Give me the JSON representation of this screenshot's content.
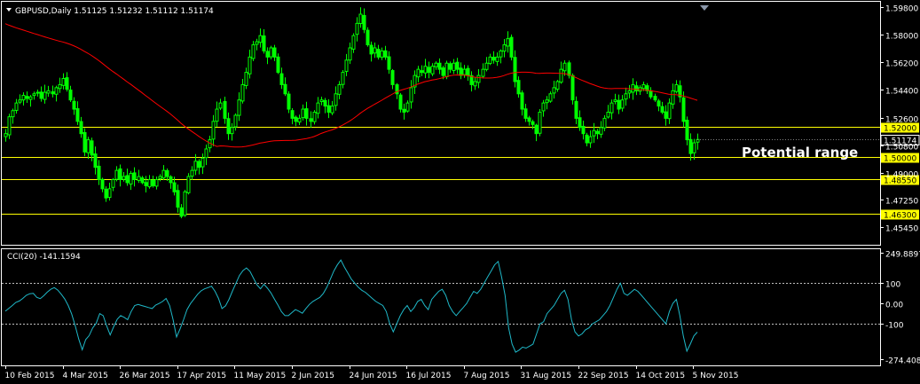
{
  "header": {
    "symbol_line": "GBPUSD,Daily  1.51125 1.51232 1.51112 1.51174",
    "indicator_line": "CCI(20) -141.1594"
  },
  "annotation": "Potential range",
  "colors": {
    "background": "#000000",
    "candle": "#00ff00",
    "moving_average": "#ff0000",
    "horizontal_level": "#ffff00",
    "cci_line": "#1fb8c8",
    "border": "#ffffff",
    "text": "#ffffff"
  },
  "chart_data": [
    {
      "type": "candlestick",
      "title": "GBPUSD,Daily",
      "ylim": [
        1.4464,
        1.5987
      ],
      "price_ticks": [
        "1.59800",
        "1.58000",
        "1.56200",
        "1.54400",
        "1.52600",
        "1.50800",
        "1.49000",
        "1.47250",
        "1.45450"
      ],
      "current_price_label": "1.51174",
      "horizontal_levels": [
        {
          "value": 1.52,
          "label": "1.52000"
        },
        {
          "value": 1.5,
          "label": "1.50000"
        },
        {
          "value": 1.4855,
          "label": "1.48550"
        },
        {
          "value": 1.463,
          "label": "1.46300"
        }
      ],
      "date_labels": [
        "10 Feb 2015",
        "4 Mar 2015",
        "26 Mar 2015",
        "17 Apr 2015",
        "11 May 2015",
        "2 Jun 2015",
        "24 Jun 2015",
        "16 Jul 2015",
        "7 Aug 2015",
        "31 Aug 2015",
        "22 Sep 2015",
        "14 Oct 2015",
        "5 Nov 2015"
      ],
      "close_series": [
        1.5155,
        1.5265,
        1.5305,
        1.5355,
        1.5375,
        1.5405,
        1.5385,
        1.5395,
        1.5415,
        1.5425,
        1.5385,
        1.5425,
        1.5435,
        1.5415,
        1.5455,
        1.5475,
        1.5515,
        1.5445,
        1.5375,
        1.5315,
        1.5235,
        1.5155,
        1.5035,
        1.5115,
        1.5015,
        1.4935,
        1.4855,
        1.4795,
        1.4735,
        1.4795,
        1.4855,
        1.4915,
        1.4855,
        1.4875,
        1.4835,
        1.4895,
        1.4855,
        1.4875,
        1.4835,
        1.4815,
        1.4855,
        1.4815,
        1.4855,
        1.4875,
        1.4915,
        1.4875,
        1.4835,
        1.4775,
        1.4675,
        1.4615,
        1.4775,
        1.4875,
        1.4915,
        1.4975,
        1.4935,
        1.4995,
        1.5055,
        1.5115,
        1.5235,
        1.5315,
        1.5355,
        1.5255,
        1.5155,
        1.5195,
        1.5275,
        1.5375,
        1.5475,
        1.5555,
        1.5655,
        1.5735,
        1.5755,
        1.5795,
        1.5695,
        1.5655,
        1.5715,
        1.5655,
        1.5555,
        1.5475,
        1.5415,
        1.5315,
        1.5255,
        1.5235,
        1.5255,
        1.5315,
        1.5255,
        1.5235,
        1.5295,
        1.5355,
        1.5375,
        1.5335,
        1.5295,
        1.5335,
        1.5415,
        1.5475,
        1.5555,
        1.5635,
        1.5715,
        1.5795,
        1.5875,
        1.5935,
        1.5835,
        1.5735,
        1.5675,
        1.5715,
        1.5655,
        1.5695,
        1.5655,
        1.5575,
        1.5475,
        1.5415,
        1.5315,
        1.5295,
        1.5355,
        1.5455,
        1.5535,
        1.5575,
        1.5555,
        1.5595,
        1.5555,
        1.5595,
        1.5615,
        1.5575,
        1.5535,
        1.5615,
        1.5575,
        1.5615,
        1.5575,
        1.5535,
        1.5575,
        1.5535,
        1.5475,
        1.5495,
        1.5535,
        1.5575,
        1.5615,
        1.5655,
        1.5635,
        1.5655,
        1.5695,
        1.5735,
        1.5775,
        1.5655,
        1.5495,
        1.5415,
        1.5315,
        1.5255,
        1.5235,
        1.5215,
        1.5155,
        1.5295,
        1.5355,
        1.5375,
        1.5415,
        1.5455,
        1.5495,
        1.5575,
        1.5615,
        1.5535,
        1.5375,
        1.5255,
        1.5195,
        1.5155,
        1.5095,
        1.5135,
        1.5175,
        1.5155,
        1.5195,
        1.5255,
        1.5295,
        1.5355,
        1.5375,
        1.5315,
        1.5375,
        1.5415,
        1.5435,
        1.5475,
        1.5435,
        1.5455,
        1.5475,
        1.5435,
        1.5395,
        1.5375,
        1.5335,
        1.5295,
        1.5255,
        1.5355,
        1.5435,
        1.5475,
        1.5395,
        1.5235,
        1.5115,
        1.5025,
        1.5095,
        1.5117
      ]
    },
    {
      "type": "line",
      "title": "CCI(20)",
      "current_value": -141.1594,
      "ylim": [
        -274.4083,
        249.8897
      ],
      "ticks": [
        "249.8897",
        "100",
        "0.00",
        "-100",
        "-274.4083"
      ],
      "reference_levels": [
        100,
        -100
      ],
      "values": [
        -38,
        -24,
        -10,
        5,
        12,
        25,
        40,
        48,
        50,
        30,
        24,
        38,
        56,
        70,
        78,
        66,
        46,
        22,
        -10,
        -52,
        -110,
        -175,
        -228,
        -178,
        -158,
        -120,
        -98,
        -50,
        -60,
        -110,
        -155,
        -115,
        -78,
        -60,
        -68,
        -80,
        -40,
        -10,
        -5,
        -10,
        -15,
        -20,
        -25,
        -8,
        0,
        10,
        25,
        -10,
        -80,
        -165,
        -125,
        -80,
        -30,
        0,
        22,
        45,
        62,
        72,
        78,
        85,
        60,
        25,
        -25,
        -12,
        20,
        62,
        100,
        138,
        162,
        175,
        158,
        125,
        92,
        72,
        95,
        75,
        52,
        22,
        -8,
        -40,
        -60,
        -60,
        -45,
        -30,
        -38,
        -48,
        -25,
        -5,
        10,
        20,
        30,
        50,
        80,
        120,
        160,
        190,
        214,
        180,
        150,
        120,
        100,
        80,
        65,
        55,
        40,
        25,
        10,
        0,
        -10,
        -40,
        -100,
        -140,
        -100,
        -60,
        -30,
        -10,
        -40,
        -20,
        10,
        20,
        -10,
        -30,
        20,
        40,
        60,
        70,
        40,
        -10,
        -40,
        -60,
        -40,
        -20,
        0,
        30,
        60,
        50,
        70,
        100,
        130,
        160,
        190,
        207,
        130,
        40,
        -120,
        -200,
        -240,
        -230,
        -215,
        -220,
        -210,
        -200,
        -150,
        -100,
        -90,
        -50,
        -30,
        -10,
        20,
        50,
        65,
        20,
        -80,
        -140,
        -160,
        -150,
        -130,
        -120,
        -100,
        -90,
        -80,
        -60,
        -40,
        -10,
        30,
        70,
        100,
        50,
        40,
        55,
        70,
        60,
        40,
        20,
        0,
        -20,
        -40,
        -60,
        -80,
        -100,
        -40,
        0,
        20,
        -60,
        -160,
        -235,
        -200,
        -160,
        -141
      ]
    }
  ]
}
